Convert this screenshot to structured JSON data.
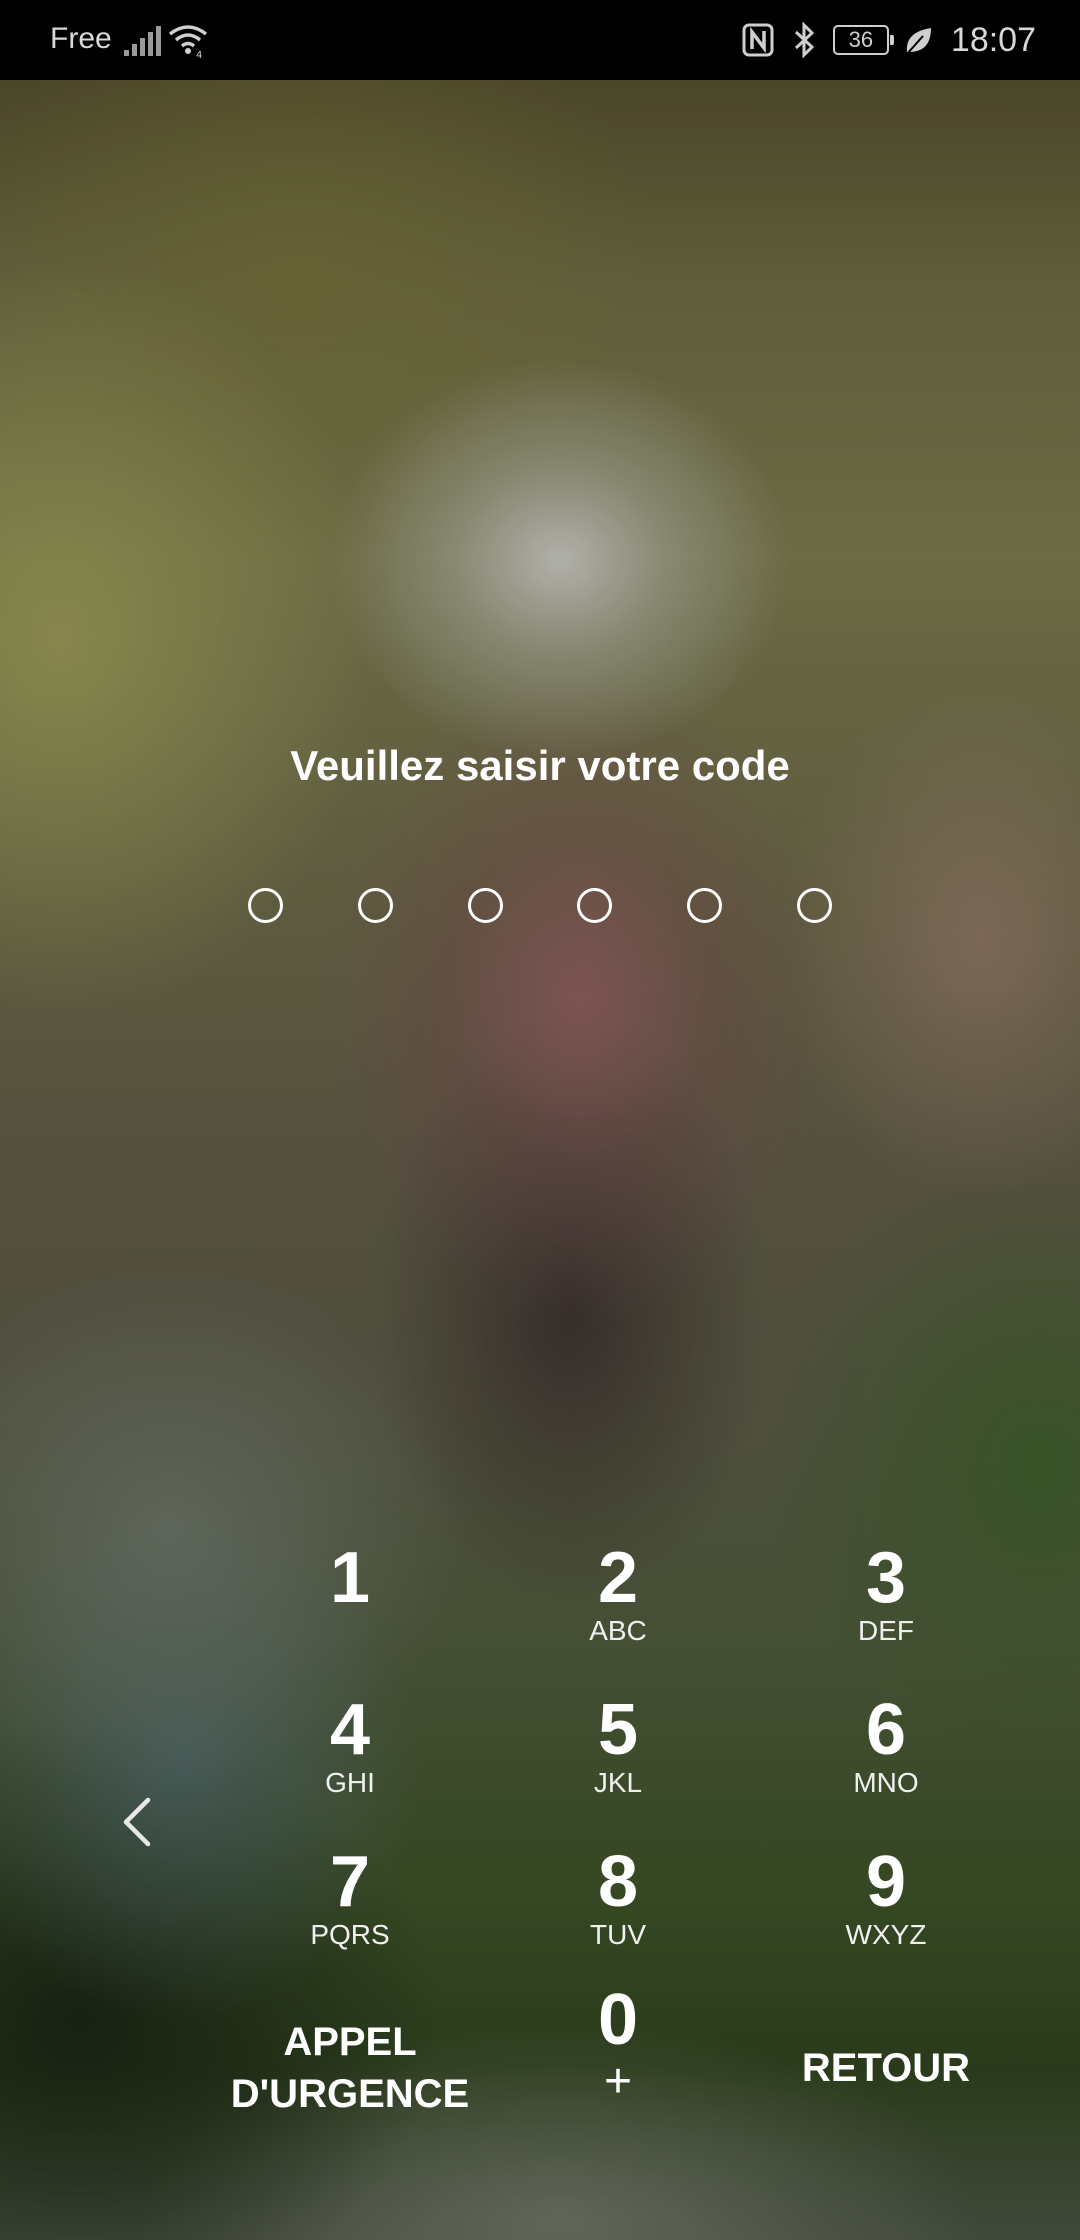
{
  "status_bar": {
    "carrier": "Free",
    "time": "18:07",
    "battery_level": "36",
    "icons": [
      "signal-icon",
      "wifi-icon",
      "nfc-icon",
      "bluetooth-icon",
      "battery-icon",
      "eco-leaf-icon"
    ]
  },
  "lock_screen": {
    "prompt": "Veuillez saisir votre code",
    "pin_length": 6,
    "pin_entered": 0
  },
  "keypad": {
    "keys": [
      {
        "num": "1",
        "letters": ""
      },
      {
        "num": "2",
        "letters": "ABC"
      },
      {
        "num": "3",
        "letters": "DEF"
      },
      {
        "num": "4",
        "letters": "GHI"
      },
      {
        "num": "5",
        "letters": "JKL"
      },
      {
        "num": "6",
        "letters": "MNO"
      },
      {
        "num": "7",
        "letters": "PQRS"
      },
      {
        "num": "8",
        "letters": "TUV"
      },
      {
        "num": "9",
        "letters": "WXYZ"
      }
    ],
    "zero": {
      "num": "0",
      "sub": "+"
    },
    "emergency_line1": "APPEL",
    "emergency_line2": "D'URGENCE",
    "back": "RETOUR"
  },
  "colors": {
    "text": "#ffffff",
    "status_bar_bg": "#000000"
  }
}
